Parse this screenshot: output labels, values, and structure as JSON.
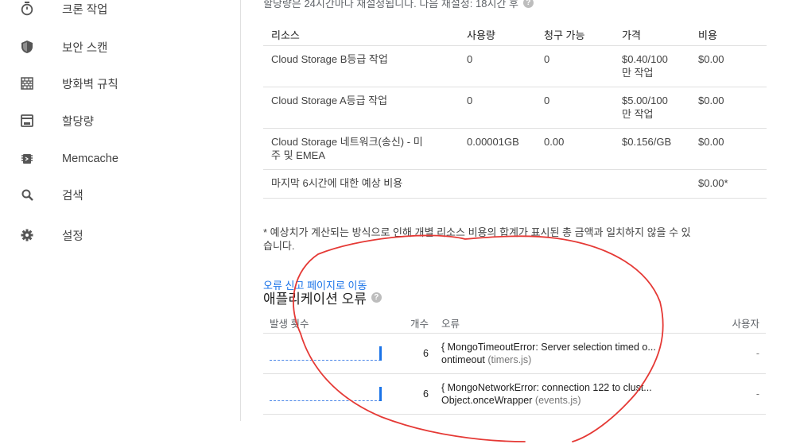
{
  "sidebar": {
    "items": [
      {
        "label": "크론 작업",
        "icon": "clock-icon"
      },
      {
        "label": "보안 스캔",
        "icon": "shield-icon"
      },
      {
        "label": "방화벽 규칙",
        "icon": "firewall-icon"
      },
      {
        "label": "할당량",
        "icon": "quota-icon"
      },
      {
        "label": "Memcache",
        "icon": "memcache-icon"
      },
      {
        "label": "검색",
        "icon": "search-icon"
      },
      {
        "label": "설정",
        "icon": "gear-icon"
      }
    ]
  },
  "quota": {
    "note": "할당량은 24시간마다 재설정됩니다. 다음 재설정: 18시간 후",
    "headers": {
      "resource": "리소스",
      "usage": "사용량",
      "billable": "청구 가능",
      "price": "가격",
      "cost": "비용"
    },
    "rows": [
      {
        "resource": "Cloud Storage B등급 작업",
        "usage": "0",
        "billable": "0",
        "price_line1": "$0.40/100",
        "price_line2": "만 작업",
        "cost": "$0.00"
      },
      {
        "resource": "Cloud Storage A등급 작업",
        "usage": "0",
        "billable": "0",
        "price_line1": "$5.00/100",
        "price_line2": "만 작업",
        "cost": "$0.00"
      },
      {
        "resource_line1": "Cloud Storage 네트워크(송신) - 미",
        "resource_line2": "주 및 EMEA",
        "usage": "0.00001GB",
        "billable": "0.00",
        "price": "$0.156/GB",
        "cost": "$0.00"
      }
    ],
    "estimate_label": "마지막 6시간에 대한 예상 비용",
    "estimate_value": "$0.00*",
    "footnote": "* 예상치가 계산되는 방식으로 인해 개별 리소스 비용의 합계가 표시된 총 금액과 일치하지 않을 수 있습니다."
  },
  "errors": {
    "link": "오류 신고 페이지로 이동",
    "title": "애플리케이션 오류",
    "headers": {
      "occurrences": "발생 횟수",
      "count": "개수",
      "error": "오류",
      "users": "사용자"
    },
    "rows": [
      {
        "count": "6",
        "message": "{ MongoTimeoutError: Server selection timed o...",
        "source": "ontimeout",
        "file": "(timers.js)",
        "users": "-"
      },
      {
        "count": "6",
        "message": "{ MongoNetworkError: connection 122 to clust...",
        "source": "Object.onceWrapper",
        "file": "(events.js)",
        "users": "-"
      }
    ]
  },
  "colors": {
    "link": "#1a73e8",
    "annotation": "#e53935"
  }
}
